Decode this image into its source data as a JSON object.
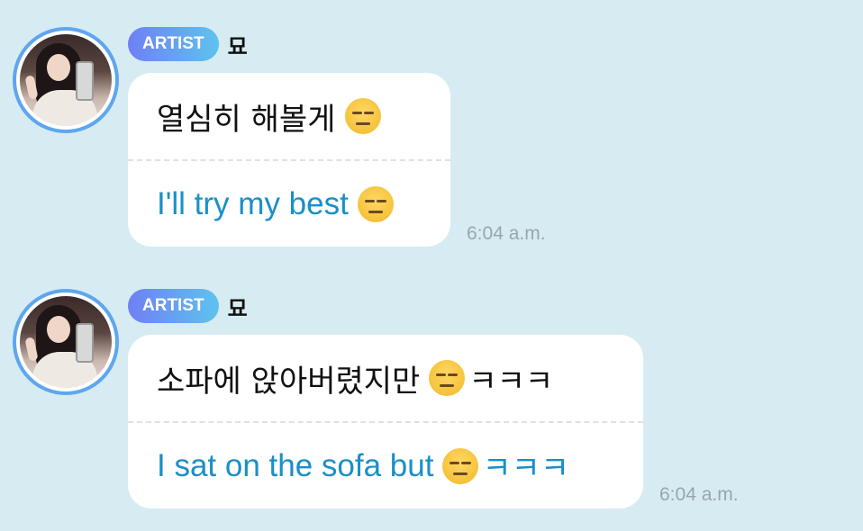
{
  "messages": [
    {
      "badge": "ARTIST",
      "name": "묘",
      "korean": "열심히 해볼게",
      "korean_suffix": "",
      "english": "I'll try my best",
      "english_suffix": "",
      "emoji": "expressionless-face-icon",
      "time": "6:04 a.m."
    },
    {
      "badge": "ARTIST",
      "name": "묘",
      "korean": "소파에 앉아버렸지만",
      "korean_suffix": "ㅋㅋㅋ",
      "english": "I sat on the sofa but",
      "english_suffix": "ㅋㅋㅋ",
      "emoji": "expressionless-face-icon",
      "time": "6:04 a.m."
    }
  ],
  "colors": {
    "background": "#d6ecf2",
    "translation_text": "#1a8fc9",
    "badge_gradient_start": "#6f7ff5",
    "badge_gradient_end": "#5ec3ee",
    "avatar_ring": "#5ea6f0"
  }
}
